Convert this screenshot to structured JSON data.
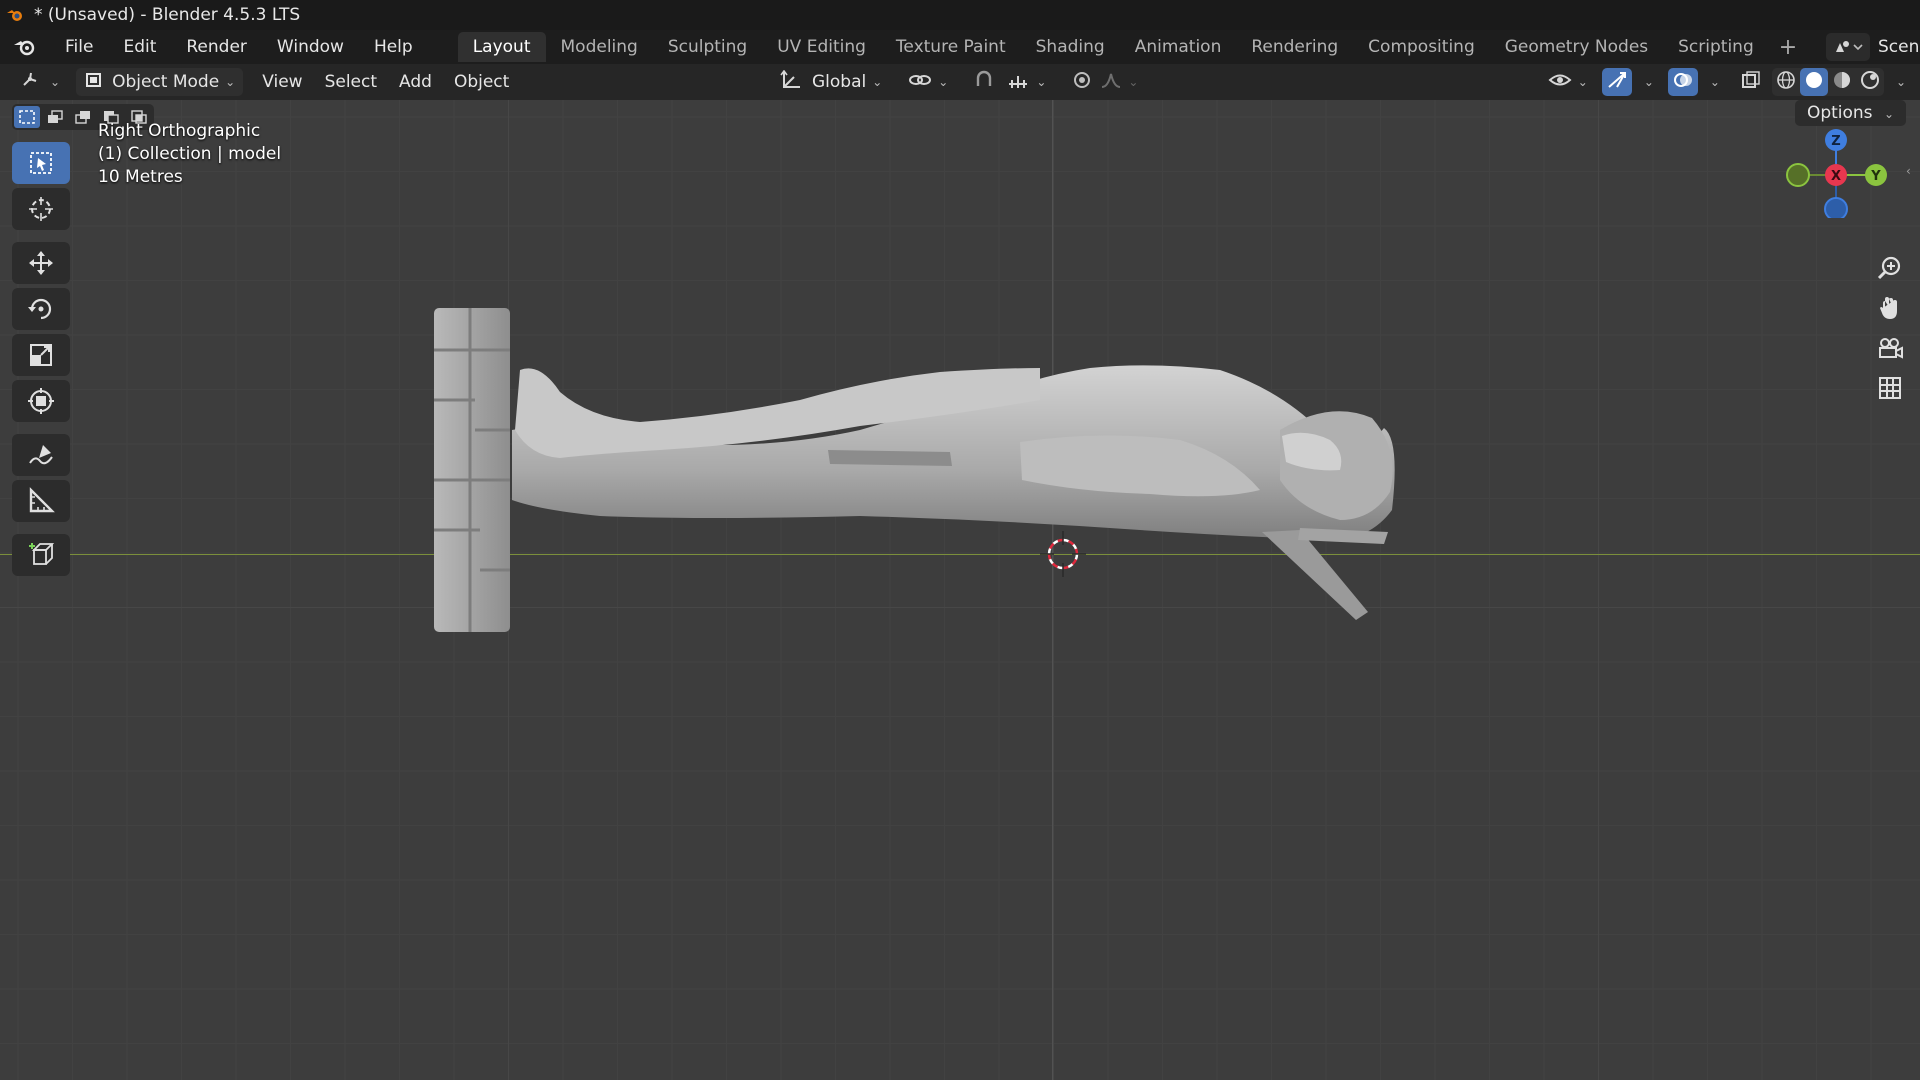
{
  "window": {
    "title": "* (Unsaved) - Blender 4.5.3 LTS"
  },
  "menus": [
    "File",
    "Edit",
    "Render",
    "Window",
    "Help"
  ],
  "workspaces": [
    "Layout",
    "Modeling",
    "Sculpting",
    "UV Editing",
    "Texture Paint",
    "Shading",
    "Animation",
    "Rendering",
    "Compositing",
    "Geometry Nodes",
    "Scripting"
  ],
  "active_workspace": "Layout",
  "scene": {
    "label": "Scen"
  },
  "viewport_header": {
    "mode": "Object Mode",
    "menus": [
      "View",
      "Select",
      "Add",
      "Object"
    ],
    "transform_orientation": "Global"
  },
  "viewport": {
    "view_name": "Right Orthographic",
    "collection_info": "(1) Collection | model",
    "scale": "10 Metres",
    "options_label": "Options"
  },
  "gizmo": {
    "x": "X",
    "y": "Y",
    "z": "Z"
  },
  "colors": {
    "accent": "#4772b3",
    "x_axis": "#e8374f",
    "y_axis": "#8bc43f",
    "z_axis": "#3f7ee0",
    "horizon": "#7b8f3b"
  },
  "tools": [
    "select-box-icon",
    "cursor-icon",
    "move-icon",
    "rotate-icon",
    "scale-icon",
    "transform-icon",
    "annotate-icon",
    "measure-icon",
    "add-cube-icon"
  ]
}
